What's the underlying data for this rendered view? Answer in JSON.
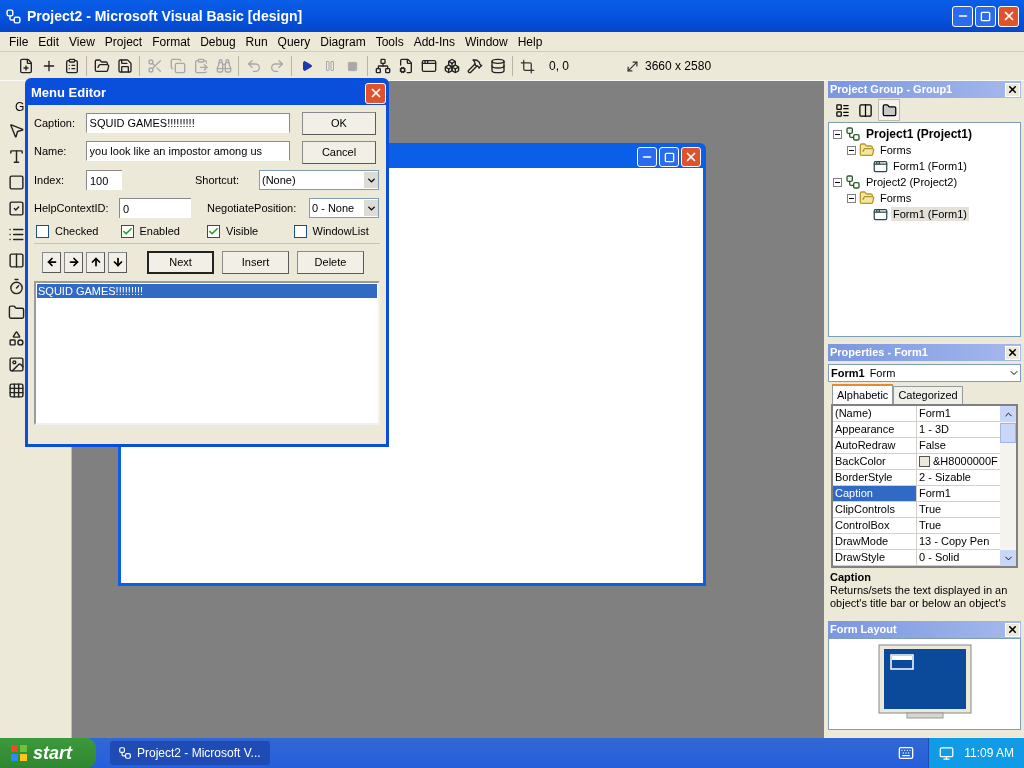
{
  "window": {
    "title": "Project2 - Microsoft Visual Basic [design]"
  },
  "menu_bar": [
    "File",
    "Edit",
    "View",
    "Project",
    "Format",
    "Debug",
    "Run",
    "Query",
    "Diagram",
    "Tools",
    "Add-Ins",
    "Window",
    "Help"
  ],
  "toolbar": {
    "position": "0, 0",
    "size": "3660 x 2580"
  },
  "toolbox": {
    "tab": "G"
  },
  "menu_editor": {
    "title": "Menu Editor",
    "fields": [
      {
        "label": "Caption:",
        "value": "SQUID GAMES!!!!!!!!!"
      },
      {
        "label": "Name:",
        "value": "you look like an impostor among us"
      }
    ],
    "buttons": [
      "OK",
      "Cancel"
    ],
    "index": {
      "label": "Index:",
      "value": "100"
    },
    "shortcut": {
      "label": "Shortcut:",
      "value": "(None)"
    },
    "help_context_id": {
      "label": "HelpContextID:",
      "value": "0"
    },
    "negotiate_position": {
      "label": "NegotiatePosition:",
      "value": "0 - None"
    },
    "checkboxes": [
      {
        "label": "Checked",
        "checked": false
      },
      {
        "label": "Enabled",
        "checked": true
      },
      {
        "label": "Visible",
        "checked": true
      },
      {
        "label": "WindowList",
        "checked": false
      }
    ],
    "actions": [
      {
        "label": "Next",
        "default": true
      },
      {
        "label": "Insert",
        "default": false
      },
      {
        "label": "Delete",
        "default": false
      }
    ],
    "menu_items": [
      {
        "label": "SQUID GAMES!!!!!!!!!",
        "selected": true
      }
    ]
  },
  "project_group": {
    "title": "Project Group - Group1",
    "tree": [
      {
        "kind": "project",
        "label": "Project1 (Project1)",
        "bold": true,
        "expanded": true,
        "selected": false,
        "children": [
          {
            "kind": "folder",
            "label": "Forms",
            "bold": false,
            "expanded": true,
            "selected": false,
            "children": [
              {
                "kind": "form",
                "label": "Form1 (Form1)",
                "bold": false,
                "selected": false
              }
            ]
          }
        ]
      },
      {
        "kind": "project",
        "label": "Project2 (Project2)",
        "bold": false,
        "expanded": true,
        "selected": false,
        "children": [
          {
            "kind": "folder",
            "label": "Forms",
            "bold": false,
            "expanded": true,
            "selected": false,
            "children": [
              {
                "kind": "form",
                "label": "Form1 (Form1)",
                "bold": false,
                "selected": true
              }
            ]
          }
        ]
      }
    ]
  },
  "properties": {
    "title": "Properties - Form1",
    "object": {
      "name": "Form1",
      "type": "Form"
    },
    "tabs": [
      {
        "label": "Alphabetic",
        "selected": true
      },
      {
        "label": "Categorized",
        "selected": false
      }
    ],
    "rows": [
      {
        "name": "(Name)",
        "value": "Form1",
        "selected": false
      },
      {
        "name": "Appearance",
        "value": "1 - 3D",
        "selected": false
      },
      {
        "name": "AutoRedraw",
        "value": "False",
        "selected": false
      },
      {
        "name": "BackColor",
        "value": "&H8000000F",
        "selected": false,
        "color": "#ece9d8"
      },
      {
        "name": "BorderStyle",
        "value": "2 - Sizable",
        "selected": false
      },
      {
        "name": "Caption",
        "value": "Form1",
        "selected": true
      },
      {
        "name": "ClipControls",
        "value": "True",
        "selected": false
      },
      {
        "name": "ControlBox",
        "value": "True",
        "selected": false
      },
      {
        "name": "DrawMode",
        "value": "13 - Copy Pen",
        "selected": false
      },
      {
        "name": "DrawStyle",
        "value": "0 - Solid",
        "selected": false
      }
    ],
    "description": {
      "title": "Caption",
      "text": "Returns/sets the text displayed in an object's title bar or below an object's"
    }
  },
  "form_layout": {
    "title": "Form Layout"
  },
  "taskbar": {
    "start": "start",
    "tasks": [
      {
        "label": "Project2 - Microsoft V...",
        "selected": true
      }
    ],
    "clock": "11:09 AM"
  }
}
